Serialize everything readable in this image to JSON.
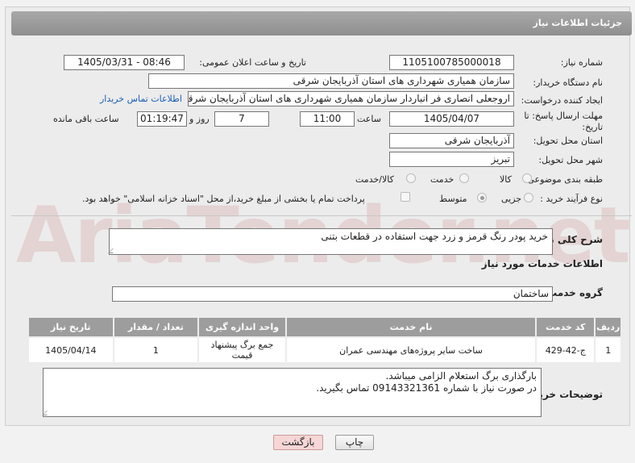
{
  "header": {
    "title": "جزئیات اطلاعات نیاز"
  },
  "fields": {
    "need_number_label": "شماره نیاز:",
    "need_number": "1105100785000018",
    "announce_label": "تاریخ و ساعت اعلان عمومی:",
    "announce_value": "1405/03/31 - 08:46",
    "buyer_org_label": "نام دستگاه خریدار:",
    "buyer_org": "سازمان همیاری شهرداری های استان آذربایجان شرقی",
    "creator_label": "ایجاد کننده درخواست:",
    "creator": "اروجعلی انصاری فر انباردار سازمان همیاری شهرداری های استان آذربایجان شرقی",
    "contact_link": "اطلاعات تماس خریدار",
    "deadline_label": "مهلت ارسال پاسخ: تا تاریخ:",
    "deadline_date": "1405/04/07",
    "time_label": "ساعت",
    "deadline_time": "11:00",
    "days_value": "7",
    "days_label": "روز و",
    "remaining_time": "01:19:47",
    "remaining_label": "ساعت باقی مانده",
    "province_label": "استان محل تحویل:",
    "province": "آذربایجان شرقی",
    "city_label": "شهر محل تحویل:",
    "city": "تبریز",
    "category_label": "طبقه بندی موضوعی:",
    "category_options": [
      "کالا",
      "خدمت",
      "کالا/خدمت"
    ],
    "process_label": "نوع فرآیند خرید :",
    "process_options": [
      "جزیی",
      "متوسط"
    ],
    "payment_note": "پرداخت تمام یا بخشی از مبلغ خرید،از محل \"اسناد خزانه اسلامی\" خواهد بود."
  },
  "summary": {
    "label": "شرح کلی نیاز:",
    "text": "خرید پودر رنگ قرمز و زرد جهت استفاده در قطعات بتنی"
  },
  "services": {
    "section_title": "اطلاعات خدمات مورد نیاز",
    "group_label": "گروه خدمت:",
    "group_value": "ساختمان",
    "columns": [
      "ردیف",
      "کد خدمت",
      "نام خدمت",
      "واحد اندازه گیری",
      "تعداد / مقدار",
      "تاریخ نیاز"
    ],
    "rows": [
      [
        "1",
        "ج-42-429",
        "ساخت سایر پروژه‌های مهندسی عمران",
        "جمع برگ پیشنهاد قیمت",
        "1",
        "1405/04/14"
      ]
    ]
  },
  "buyer_notes": {
    "label": "توضیحات خریدار:",
    "line1": "بارگذاری برگ استعلام الزامی میباشد.",
    "line2": "در صورت نیاز با شماره 09143321361 تماس بگیرید."
  },
  "buttons": {
    "print": "چاپ",
    "back": "بازگشت"
  },
  "watermark": "AriaTender.net",
  "colors": {
    "header": "#999999",
    "link": "#1a5fb4",
    "back_button": "#f6d6d6"
  }
}
